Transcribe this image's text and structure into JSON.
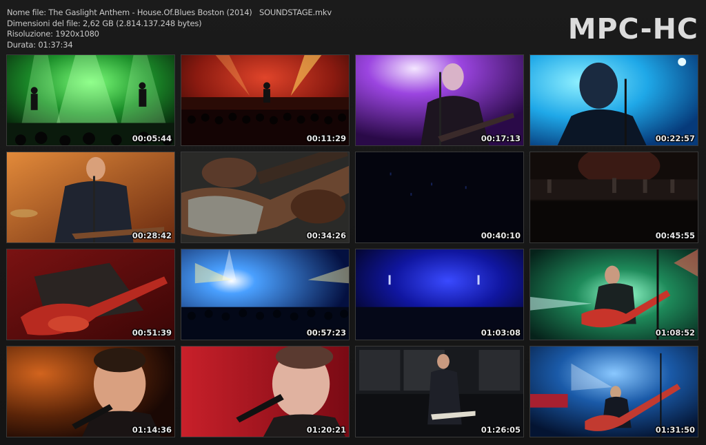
{
  "info": {
    "file_name": "Nome file: The Gaslight Anthem - House.Of.Blues Boston (2014)   SOUNDSTAGE.mkv",
    "file_size": "Dimensioni del file: 2,62 GB (2.814.137.248 bytes)",
    "resolution": "Risoluzione: 1920x1080",
    "duration": "Durata: 01:37:34"
  },
  "logo": "MPC-HC",
  "thumbnails": [
    {
      "time": "00:05:44",
      "scene": "green-stage-band"
    },
    {
      "time": "00:11:29",
      "scene": "red-stage-crowd"
    },
    {
      "time": "00:17:13",
      "scene": "purple-singer-guitar"
    },
    {
      "time": "00:22:57",
      "scene": "cyan-singer-closeup"
    },
    {
      "time": "00:28:42",
      "scene": "orange-singer-guitar"
    },
    {
      "time": "00:34:26",
      "scene": "guitar-closeup"
    },
    {
      "time": "00:40:10",
      "scene": "dark-blue-stage"
    },
    {
      "time": "00:45:55",
      "scene": "dim-stage-wide"
    },
    {
      "time": "00:51:39",
      "scene": "red-guitarist"
    },
    {
      "time": "00:57:23",
      "scene": "blue-lights-crowd"
    },
    {
      "time": "01:03:08",
      "scene": "blue-stage-dark"
    },
    {
      "time": "01:08:52",
      "scene": "green-red-guitar"
    },
    {
      "time": "01:14:36",
      "scene": "orange-singer-mic"
    },
    {
      "time": "01:20:21",
      "scene": "red-singer-mic"
    },
    {
      "time": "01:26:05",
      "scene": "singer-amps"
    },
    {
      "time": "01:31:50",
      "scene": "blue-stage-red-guitar"
    }
  ]
}
